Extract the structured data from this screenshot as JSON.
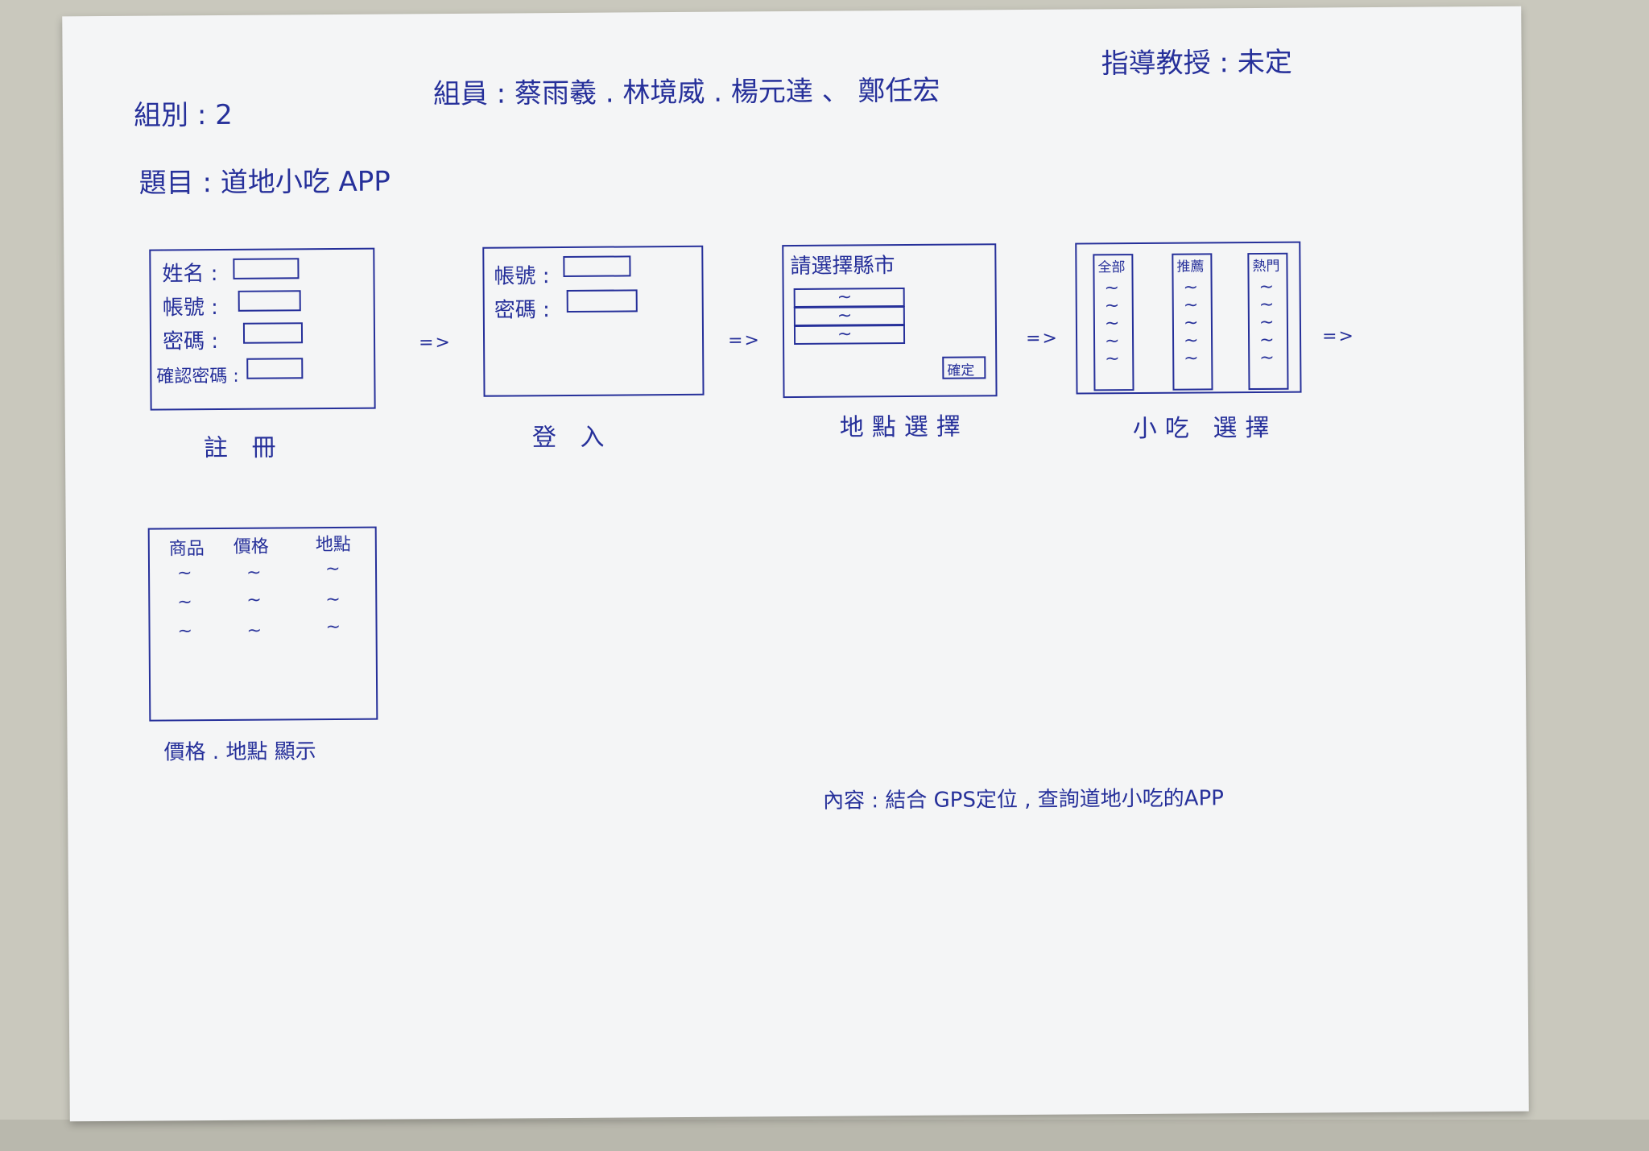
{
  "header": {
    "group": "組別 : 2",
    "members": "組員 : 蔡雨羲 . 林境威 . 楊元達 、 鄭任宏",
    "advisor": "指導教授 : 未定",
    "topic": "題目 : 道地小吃 APP"
  },
  "screens": {
    "register": {
      "caption": "註 冊",
      "fields": [
        "姓名 :",
        "帳號 :",
        "密碼 :",
        "確認密碼 :"
      ]
    },
    "login": {
      "caption": "登 入",
      "fields": [
        "帳號 :",
        "密碼 :"
      ]
    },
    "location": {
      "caption": "地點選擇",
      "prompt": "請選擇縣市",
      "options": [
        "~",
        "~",
        "~"
      ],
      "confirm_label": "確定"
    },
    "snack": {
      "caption": "小吃 選擇",
      "tabs": [
        "全部",
        "推薦",
        "熱門"
      ],
      "item": "~"
    },
    "price": {
      "caption": "價格 . 地點 顯示",
      "columns": [
        "商品",
        "價格",
        "地點"
      ],
      "cell": "~"
    }
  },
  "arrows": [
    "=>",
    "=>",
    "=>",
    "=>"
  ],
  "content": "內容 : 結合 GPS定位 , 查詢道地小吃的APP"
}
